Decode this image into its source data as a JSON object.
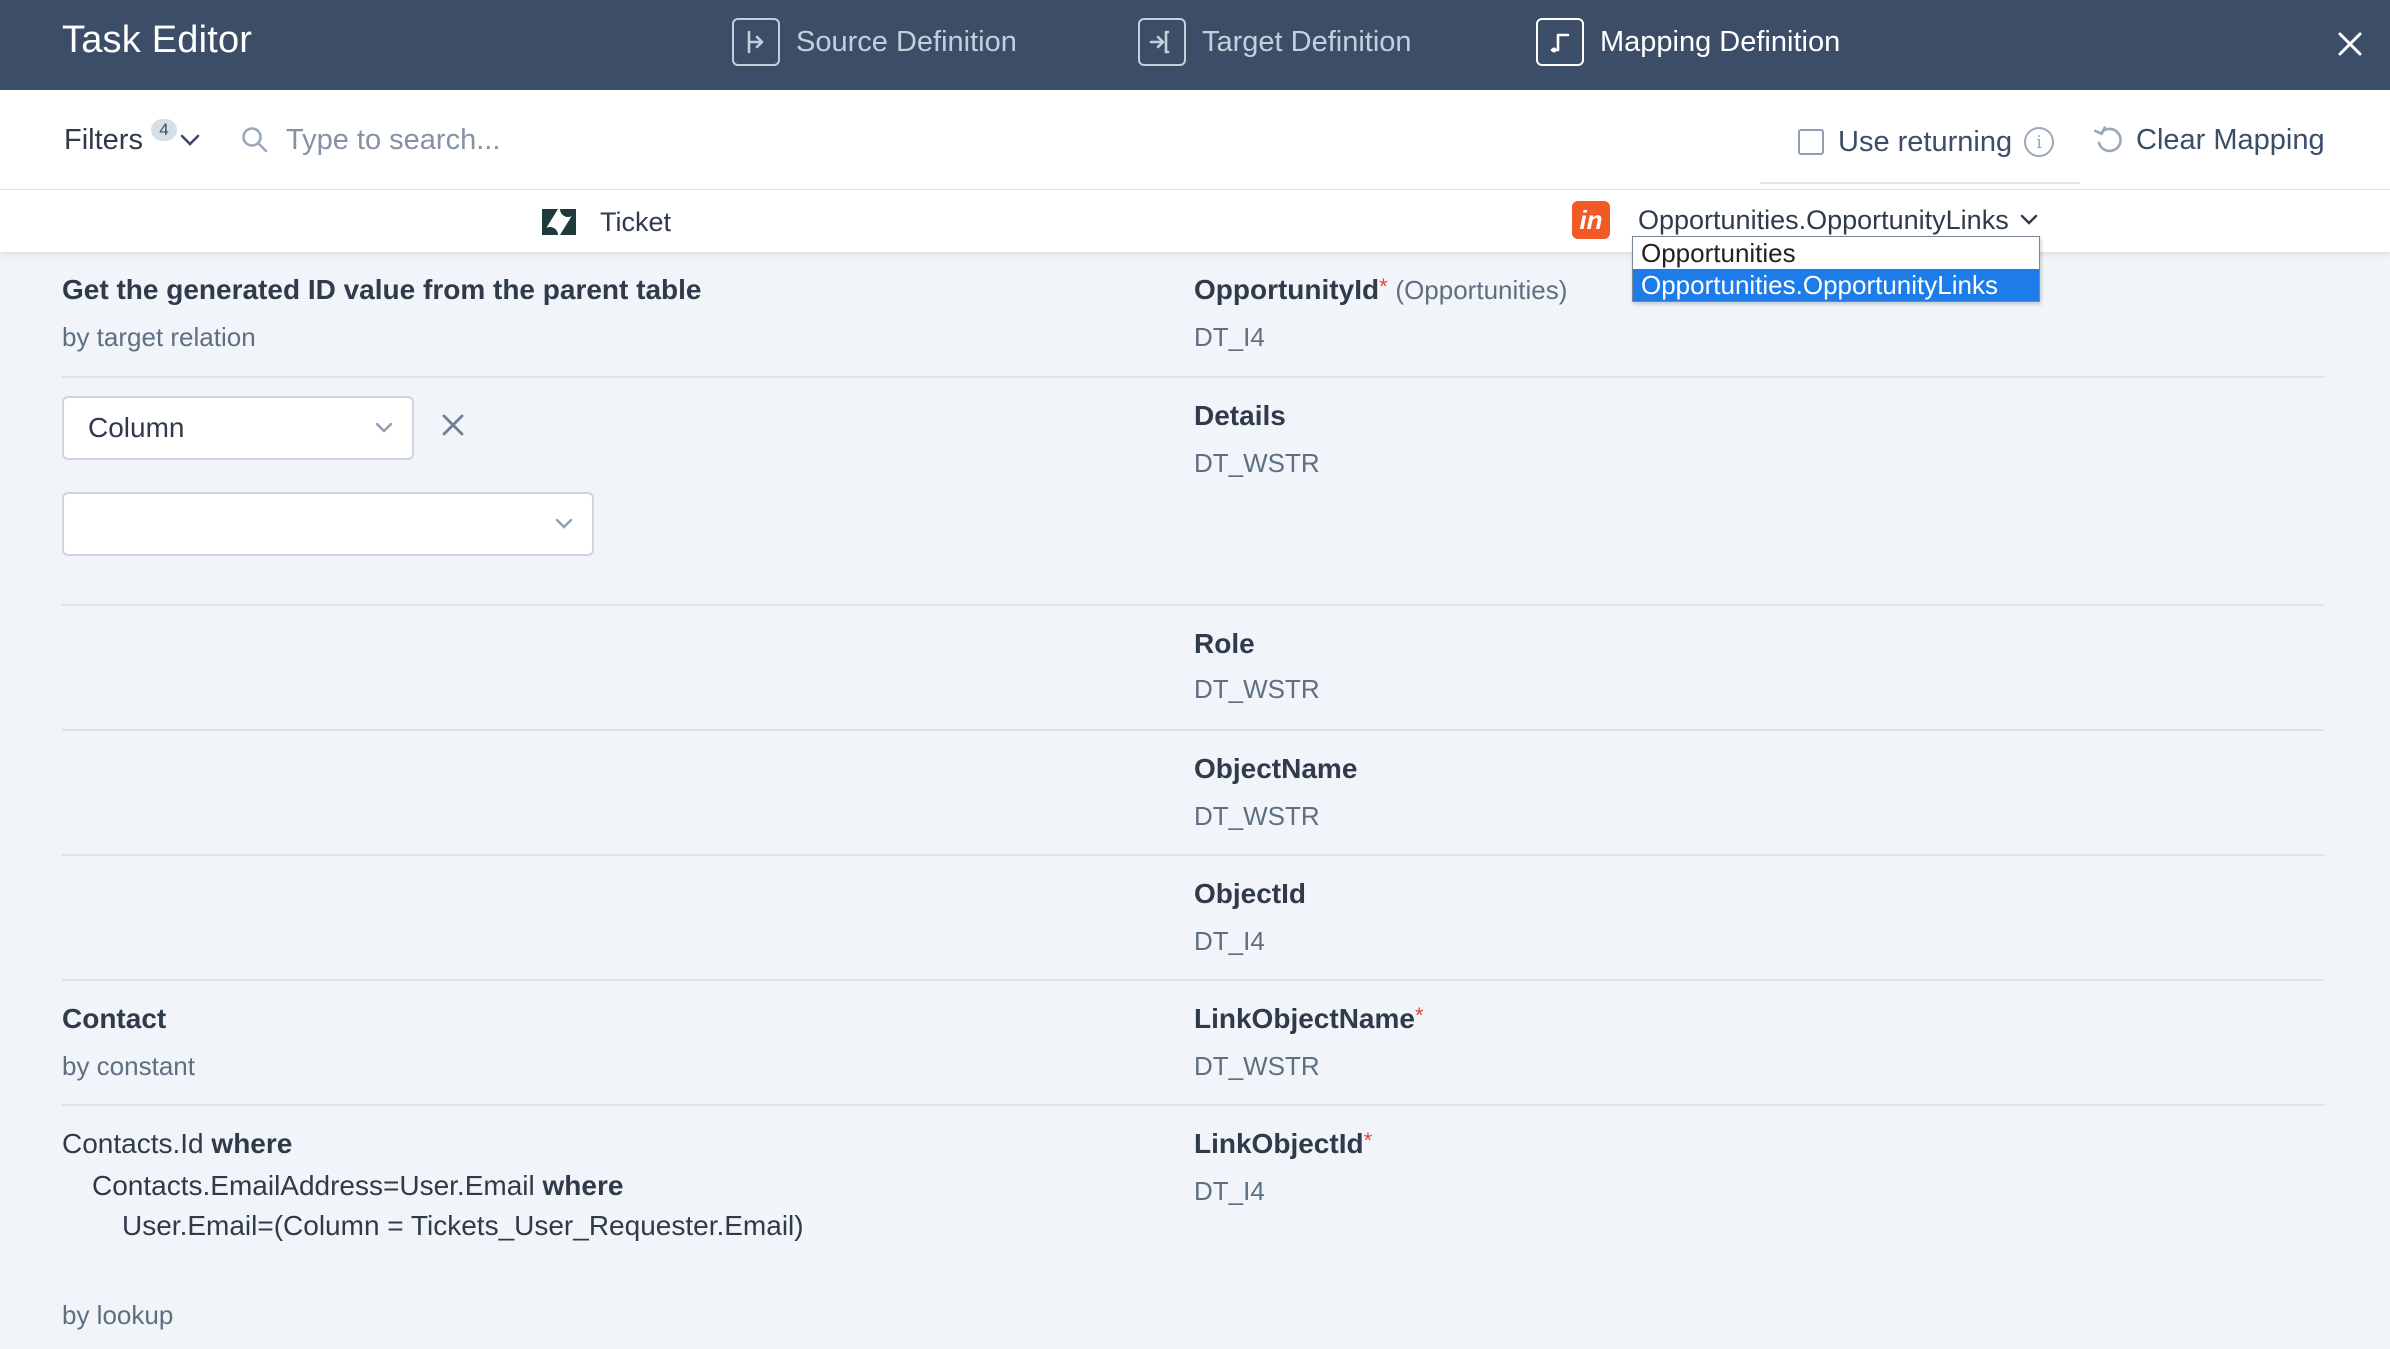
{
  "header": {
    "title": "Task Editor",
    "tabs": [
      {
        "label": "Source Definition",
        "icon": "source-definition-icon",
        "active": false
      },
      {
        "label": "Target Definition",
        "icon": "target-definition-icon",
        "active": false
      },
      {
        "label": "Mapping Definition",
        "icon": "mapping-definition-icon",
        "active": true
      }
    ],
    "close_icon": "close-icon"
  },
  "toolbar": {
    "filters_label": "Filters",
    "filters_count": "4",
    "search_placeholder": "Type to search...",
    "use_returning_label": "Use returning",
    "use_returning_checked": false,
    "clear_mapping_label": "Clear Mapping"
  },
  "columns": {
    "source_name": "Ticket",
    "source_icon": "zendesk-logo-icon",
    "target_name": "Opportunities.OpportunityLinks",
    "target_icon": "insightly-logo-icon",
    "target_logo_text": "in",
    "dropdown_options": [
      "Opportunities",
      "Opportunities.OpportunityLinks"
    ],
    "dropdown_selected": "Opportunities.OpportunityLinks"
  },
  "rows": {
    "r1": {
      "source_title": "Get the generated ID value from the parent table",
      "source_sub": "by target relation",
      "target_name": "OpportunityId",
      "target_required": "*",
      "target_note": "(Opportunities)",
      "target_type": "DT_I4"
    },
    "r2": {
      "select1_value": "Column",
      "select2_value": "",
      "target_name": "Details",
      "target_type": "DT_WSTR"
    },
    "r3": {
      "target_name": "Role",
      "target_type": "DT_WSTR"
    },
    "r4": {
      "target_name": "ObjectName",
      "target_type": "DT_WSTR"
    },
    "r5": {
      "target_name": "ObjectId",
      "target_type": "DT_I4"
    },
    "r6": {
      "source_title": "Contact",
      "source_sub": "by constant",
      "target_name": "LinkObjectName",
      "target_required": "*",
      "target_type": "DT_WSTR"
    },
    "r7": {
      "line1_a": "Contacts.Id",
      "line1_b": "where",
      "line2_a": "Contacts.EmailAddress=User.Email",
      "line2_b": "where",
      "line3": "User.Email=(Column = Tickets_User_Requester.Email)",
      "source_sub": "by lookup",
      "target_name": "LinkObjectId",
      "target_required": "*",
      "target_type": "DT_I4"
    }
  },
  "colors": {
    "header_bg": "#3c4d68",
    "accent_selected": "#1e7ce8",
    "required": "#e0473c",
    "insightly_orange": "#f15a24"
  }
}
